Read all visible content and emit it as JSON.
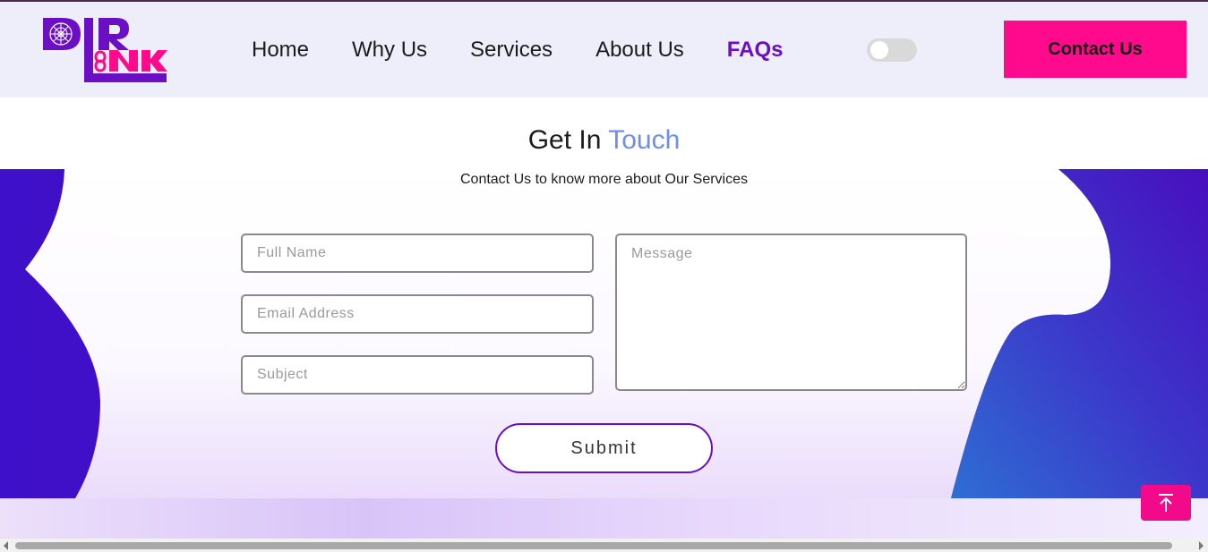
{
  "brand": {
    "logo_letters": "DIRLINK"
  },
  "nav": {
    "items": [
      {
        "label": "Home",
        "active": false
      },
      {
        "label": "Why Us",
        "active": false
      },
      {
        "label": "Services",
        "active": false
      },
      {
        "label": "About Us",
        "active": false
      },
      {
        "label": "FAQs",
        "active": true
      }
    ],
    "theme_toggle": {
      "state": "off"
    },
    "contact_label": "Contact Us"
  },
  "section": {
    "title_plain": "Get In ",
    "title_accent": "Touch",
    "subtitle": "Contact Us to know more about Our Services"
  },
  "form": {
    "full_name_placeholder": "Full Name",
    "email_placeholder": "Email Address",
    "subject_placeholder": "Subject",
    "message_placeholder": "Message",
    "submit_label": "Submit"
  },
  "icons": {
    "scroll_top": "arrow-up-to-line-icon",
    "theme": "toggle-switch"
  },
  "colors": {
    "accent_pink": "#ff0a8c",
    "accent_purple": "#6a0fc4",
    "band_blue": "#3e10c9",
    "title_accent": "#6d8ef0",
    "header_bg": "#eeeefb"
  }
}
